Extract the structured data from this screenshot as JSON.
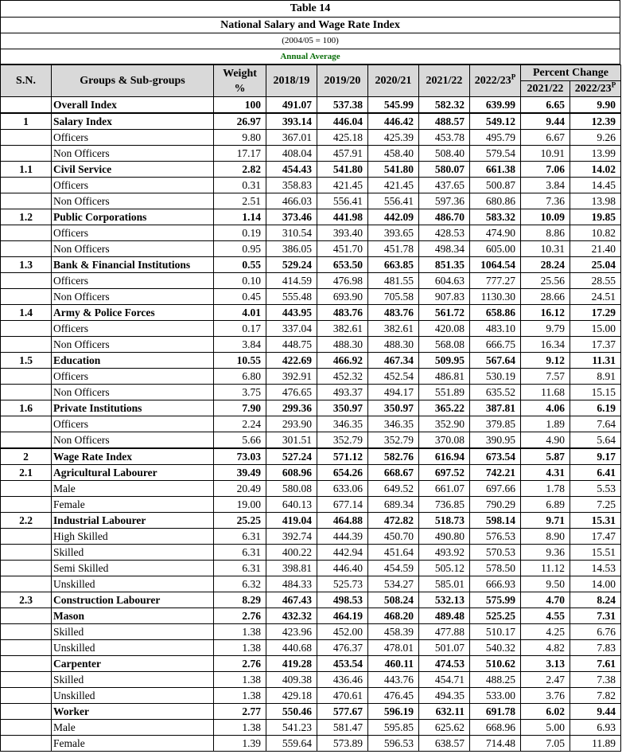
{
  "title": "Table 14",
  "subtitle": "National Salary and Wage Rate Index",
  "base": "(2004/05 = 100)",
  "period": "Annual Average",
  "headers": {
    "sn": "S.N.",
    "groups": "Groups & Sub-groups",
    "weight": "Weight %",
    "y1": "2018/19",
    "y2": "2019/20",
    "y3": "2020/21",
    "y4": "2021/22",
    "y5": "2022/23",
    "y5_sup": "P",
    "pc": "Percent Change",
    "pc1": "2021/22",
    "pc2": "2022/23",
    "pc2_sup": "P"
  },
  "rows": [
    {
      "sn": "",
      "name": "Overall Index",
      "bold": true,
      "vals": [
        "100",
        "491.07",
        "537.38",
        "545.99",
        "582.32",
        "639.99",
        "6.65",
        "9.90"
      ]
    },
    {
      "sn": "1",
      "name": "Salary Index",
      "bold": true,
      "sec": true,
      "vals": [
        "26.97",
        "393.14",
        "446.04",
        "446.42",
        "488.57",
        "549.12",
        "9.44",
        "12.39"
      ]
    },
    {
      "sn": "",
      "name": "Officers",
      "bold": false,
      "vals": [
        "9.80",
        "367.01",
        "425.18",
        "425.39",
        "453.78",
        "495.79",
        "6.67",
        "9.26"
      ]
    },
    {
      "sn": "",
      "name": "Non Officers",
      "bold": false,
      "vals": [
        "17.17",
        "408.04",
        "457.91",
        "458.40",
        "508.40",
        "579.54",
        "10.91",
        "13.99"
      ]
    },
    {
      "sn": "1.1",
      "name": "Civil Service",
      "bold": true,
      "vals": [
        "2.82",
        "454.43",
        "541.80",
        "541.80",
        "580.07",
        "661.38",
        "7.06",
        "14.02"
      ]
    },
    {
      "sn": "",
      "name": "Officers",
      "bold": false,
      "vals": [
        "0.31",
        "358.83",
        "421.45",
        "421.45",
        "437.65",
        "500.87",
        "3.84",
        "14.45"
      ]
    },
    {
      "sn": "",
      "name": "Non Officers",
      "bold": false,
      "vals": [
        "2.51",
        "466.03",
        "556.41",
        "556.41",
        "597.36",
        "680.86",
        "7.36",
        "13.98"
      ]
    },
    {
      "sn": "1.2",
      "name": "Public Corporations",
      "bold": true,
      "vals": [
        "1.14",
        "373.46",
        "441.98",
        "442.09",
        "486.70",
        "583.32",
        "10.09",
        "19.85"
      ]
    },
    {
      "sn": "",
      "name": "Officers",
      "bold": false,
      "vals": [
        "0.19",
        "310.54",
        "393.40",
        "393.65",
        "428.53",
        "474.90",
        "8.86",
        "10.82"
      ]
    },
    {
      "sn": "",
      "name": "Non Officers",
      "bold": false,
      "vals": [
        "0.95",
        "386.05",
        "451.70",
        "451.78",
        "498.34",
        "605.00",
        "10.31",
        "21.40"
      ]
    },
    {
      "sn": "1.3",
      "name": "Bank & Financial Institutions",
      "bold": true,
      "vals": [
        "0.55",
        "529.24",
        "653.50",
        "663.85",
        "851.35",
        "1064.54",
        "28.24",
        "25.04"
      ]
    },
    {
      "sn": "",
      "name": "Officers",
      "bold": false,
      "vals": [
        "0.10",
        "414.59",
        "476.98",
        "481.55",
        "604.63",
        "777.27",
        "25.56",
        "28.55"
      ]
    },
    {
      "sn": "",
      "name": "Non Officers",
      "bold": false,
      "vals": [
        "0.45",
        "555.48",
        "693.90",
        "705.58",
        "907.83",
        "1130.30",
        "28.66",
        "24.51"
      ]
    },
    {
      "sn": "1.4",
      "name": "Army  & Police Forces",
      "bold": true,
      "vals": [
        "4.01",
        "443.95",
        "483.76",
        "483.76",
        "561.72",
        "658.86",
        "16.12",
        "17.29"
      ]
    },
    {
      "sn": "",
      "name": "Officers",
      "bold": false,
      "vals": [
        "0.17",
        "337.04",
        "382.61",
        "382.61",
        "420.08",
        "483.10",
        "9.79",
        "15.00"
      ]
    },
    {
      "sn": "",
      "name": "Non Officers",
      "bold": false,
      "vals": [
        "3.84",
        "448.75",
        "488.30",
        "488.30",
        "568.08",
        "666.75",
        "16.34",
        "17.37"
      ]
    },
    {
      "sn": "1.5",
      "name": "Education",
      "bold": true,
      "vals": [
        "10.55",
        "422.69",
        "466.92",
        "467.34",
        "509.95",
        "567.64",
        "9.12",
        "11.31"
      ]
    },
    {
      "sn": "",
      "name": "Officers",
      "bold": false,
      "vals": [
        "6.80",
        "392.91",
        "452.32",
        "452.54",
        "486.81",
        "530.19",
        "7.57",
        "8.91"
      ]
    },
    {
      "sn": "",
      "name": "Non Officers",
      "bold": false,
      "vals": [
        "3.75",
        "476.65",
        "493.37",
        "494.17",
        "551.89",
        "635.52",
        "11.68",
        "15.15"
      ]
    },
    {
      "sn": "1.6",
      "name": "Private Institutions",
      "bold": true,
      "vals": [
        "7.90",
        "299.36",
        "350.97",
        "350.97",
        "365.22",
        "387.81",
        "4.06",
        "6.19"
      ]
    },
    {
      "sn": "",
      "name": "Officers",
      "bold": false,
      "vals": [
        "2.24",
        "293.90",
        "346.35",
        "346.35",
        "352.90",
        "379.85",
        "1.89",
        "7.64"
      ]
    },
    {
      "sn": "",
      "name": "Non Officers",
      "bold": false,
      "vals": [
        "5.66",
        "301.51",
        "352.79",
        "352.79",
        "370.08",
        "390.95",
        "4.90",
        "5.64"
      ]
    },
    {
      "sn": "2",
      "name": "Wage Rate Index",
      "bold": true,
      "sec": true,
      "vals": [
        "73.03",
        "527.24",
        "571.12",
        "582.76",
        "616.94",
        "673.54",
        "5.87",
        "9.17"
      ]
    },
    {
      "sn": "2.1",
      "name": "Agricultural Labourer",
      "bold": true,
      "vals": [
        "39.49",
        "608.96",
        "654.26",
        "668.67",
        "697.52",
        "742.21",
        "4.31",
        "6.41"
      ]
    },
    {
      "sn": "",
      "name": "Male",
      "bold": false,
      "vals": [
        "20.49",
        "580.08",
        "633.06",
        "649.52",
        "661.07",
        "697.66",
        "1.78",
        "5.53"
      ]
    },
    {
      "sn": "",
      "name": "Female",
      "bold": false,
      "vals": [
        "19.00",
        "640.13",
        "677.14",
        "689.34",
        "736.85",
        "790.29",
        "6.89",
        "7.25"
      ]
    },
    {
      "sn": "2.2",
      "name": "Industrial Labourer",
      "bold": true,
      "vals": [
        "25.25",
        "419.04",
        "464.88",
        "472.82",
        "518.73",
        "598.14",
        "9.71",
        "15.31"
      ]
    },
    {
      "sn": "",
      "name": "High Skilled",
      "bold": false,
      "vals": [
        "6.31",
        "392.74",
        "444.39",
        "450.70",
        "490.80",
        "576.53",
        "8.90",
        "17.47"
      ]
    },
    {
      "sn": "",
      "name": "Skilled",
      "bold": false,
      "vals": [
        "6.31",
        "400.22",
        "442.94",
        "451.64",
        "493.92",
        "570.53",
        "9.36",
        "15.51"
      ]
    },
    {
      "sn": "",
      "name": "Semi Skilled",
      "bold": false,
      "vals": [
        "6.31",
        "398.81",
        "446.40",
        "454.59",
        "505.12",
        "578.50",
        "11.12",
        "14.53"
      ]
    },
    {
      "sn": "",
      "name": "Unskilled",
      "bold": false,
      "vals": [
        "6.32",
        "484.33",
        "525.73",
        "534.27",
        "585.01",
        "666.93",
        "9.50",
        "14.00"
      ]
    },
    {
      "sn": "2.3",
      "name": "Construction Labourer",
      "bold": true,
      "vals": [
        "8.29",
        "467.43",
        "498.53",
        "508.24",
        "532.13",
        "575.99",
        "4.70",
        "8.24"
      ]
    },
    {
      "sn": "",
      "name": "Mason",
      "bold": true,
      "vals": [
        "2.76",
        "432.32",
        "464.19",
        "468.20",
        "489.48",
        "525.25",
        "4.55",
        "7.31"
      ]
    },
    {
      "sn": "",
      "name": "Skilled",
      "bold": false,
      "vals": [
        "1.38",
        "423.96",
        "452.00",
        "458.39",
        "477.88",
        "510.17",
        "4.25",
        "6.76"
      ]
    },
    {
      "sn": "",
      "name": "Unskilled",
      "bold": false,
      "vals": [
        "1.38",
        "440.68",
        "476.37",
        "478.01",
        "501.07",
        "540.32",
        "4.82",
        "7.83"
      ]
    },
    {
      "sn": "",
      "name": "Carpenter",
      "bold": true,
      "vals": [
        "2.76",
        "419.28",
        "453.54",
        "460.11",
        "474.53",
        "510.62",
        "3.13",
        "7.61"
      ]
    },
    {
      "sn": "",
      "name": "Skilled",
      "bold": false,
      "vals": [
        "1.38",
        "409.38",
        "436.46",
        "443.76",
        "454.71",
        "488.25",
        "2.47",
        "7.38"
      ]
    },
    {
      "sn": "",
      "name": "Unskilled",
      "bold": false,
      "vals": [
        "1.38",
        "429.18",
        "470.61",
        "476.45",
        "494.35",
        "533.00",
        "3.76",
        "7.82"
      ]
    },
    {
      "sn": "",
      "name": "Worker",
      "bold": true,
      "vals": [
        "2.77",
        "550.46",
        "577.67",
        "596.19",
        "632.11",
        "691.78",
        "6.02",
        "9.44"
      ]
    },
    {
      "sn": "",
      "name": "Male",
      "bold": false,
      "vals": [
        "1.38",
        "541.23",
        "581.47",
        "595.85",
        "625.62",
        "668.96",
        "5.00",
        "6.93"
      ]
    },
    {
      "sn": "",
      "name": "Female",
      "bold": false,
      "vals": [
        "1.39",
        "559.64",
        "573.89",
        "596.53",
        "638.57",
        "714.48",
        "7.05",
        "11.89"
      ]
    }
  ]
}
